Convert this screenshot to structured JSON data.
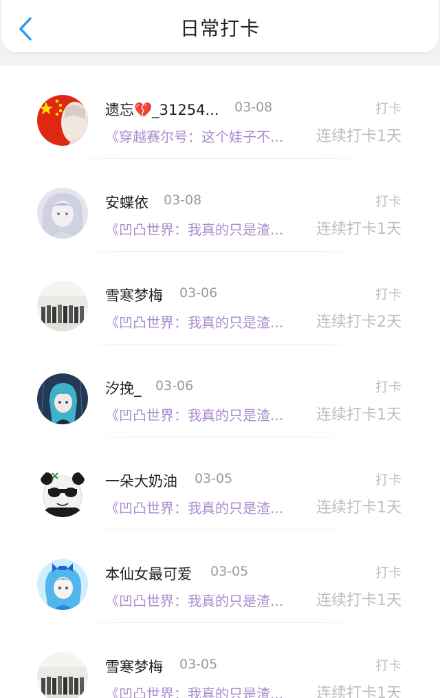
{
  "header": {
    "title": "日常打卡",
    "back_icon": "chevron-left-icon",
    "accent": "#2d9cf0"
  },
  "colors": {
    "snippet": "#a98ccf",
    "streak": "#bdbdbd",
    "date": "#999999"
  },
  "entries": [
    {
      "name": "遗忘💔_31254...",
      "date": "03-08",
      "status": "打卡",
      "snippet": "《穿越赛尔号：这个娃子不...",
      "streak": "连续打卡1天",
      "avatar": "flag-avatar"
    },
    {
      "name": "安蝶依",
      "date": "03-08",
      "status": "打卡",
      "snippet": "《凹凸世界：我真的只是渣...",
      "streak": "连续打卡1天",
      "avatar": "anime-girl-pale-avatar"
    },
    {
      "name": "雪寒梦梅",
      "date": "03-06",
      "status": "打卡",
      "snippet": "《凹凸世界：我真的只是渣...",
      "streak": "连续打卡2天",
      "avatar": "group-photo-avatar"
    },
    {
      "name": "汐挽_",
      "date": "03-06",
      "status": "打卡",
      "snippet": "《凹凸世界：我真的只是渣...",
      "streak": "连续打卡1天",
      "avatar": "anime-rain-avatar"
    },
    {
      "name": "一朵大奶油",
      "date": "03-05",
      "status": "打卡",
      "snippet": "《凹凸世界：我真的只是渣...",
      "streak": "连续打卡1天",
      "avatar": "panda-meme-avatar"
    },
    {
      "name": "本仙女最可爱",
      "date": "03-05",
      "status": "打卡",
      "snippet": "《凹凸世界：我真的只是渣...",
      "streak": "连续打卡1天",
      "avatar": "anime-blue-hair-avatar"
    },
    {
      "name": "雪寒梦梅",
      "date": "03-05",
      "status": "打卡",
      "snippet": "《凹凸世界：我真的只是渣...",
      "streak": "连续打卡1天",
      "avatar": "group-photo-avatar"
    }
  ]
}
